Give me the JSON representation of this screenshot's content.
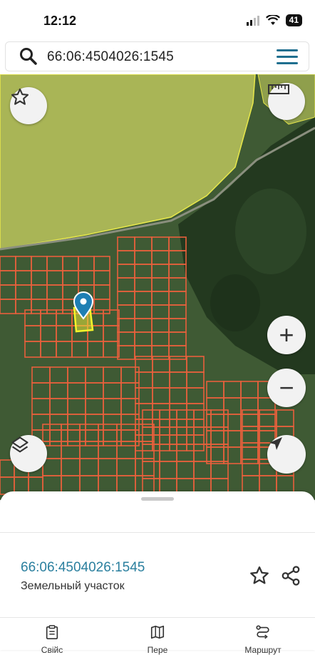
{
  "status_bar": {
    "time": "12:12",
    "battery": "41"
  },
  "search": {
    "query": "66:06:4504026:1545"
  },
  "map": {
    "colors": {
      "field": "#a8b556",
      "forest": "#2e4a2c",
      "parcel_lines": "#e8603c",
      "selected": "#f0f02a",
      "marker": "#1e7fb3"
    }
  },
  "controls": {
    "favorite": "star-icon",
    "ruler": "ruler-icon",
    "zoom_in": "+",
    "zoom_out": "−",
    "layers": "layers-icon",
    "locate": "navigation-arrow-icon"
  },
  "sheet": {
    "parcel_id": "66:06:4504026:1545",
    "parcel_type": "Земельный участок"
  },
  "bottom_tabs": [
    {
      "label": "Свійс",
      "icon": "clipboard-icon"
    },
    {
      "label": "Пере",
      "icon": "map-icon"
    },
    {
      "label": "Маршрут",
      "icon": "route-icon"
    }
  ]
}
